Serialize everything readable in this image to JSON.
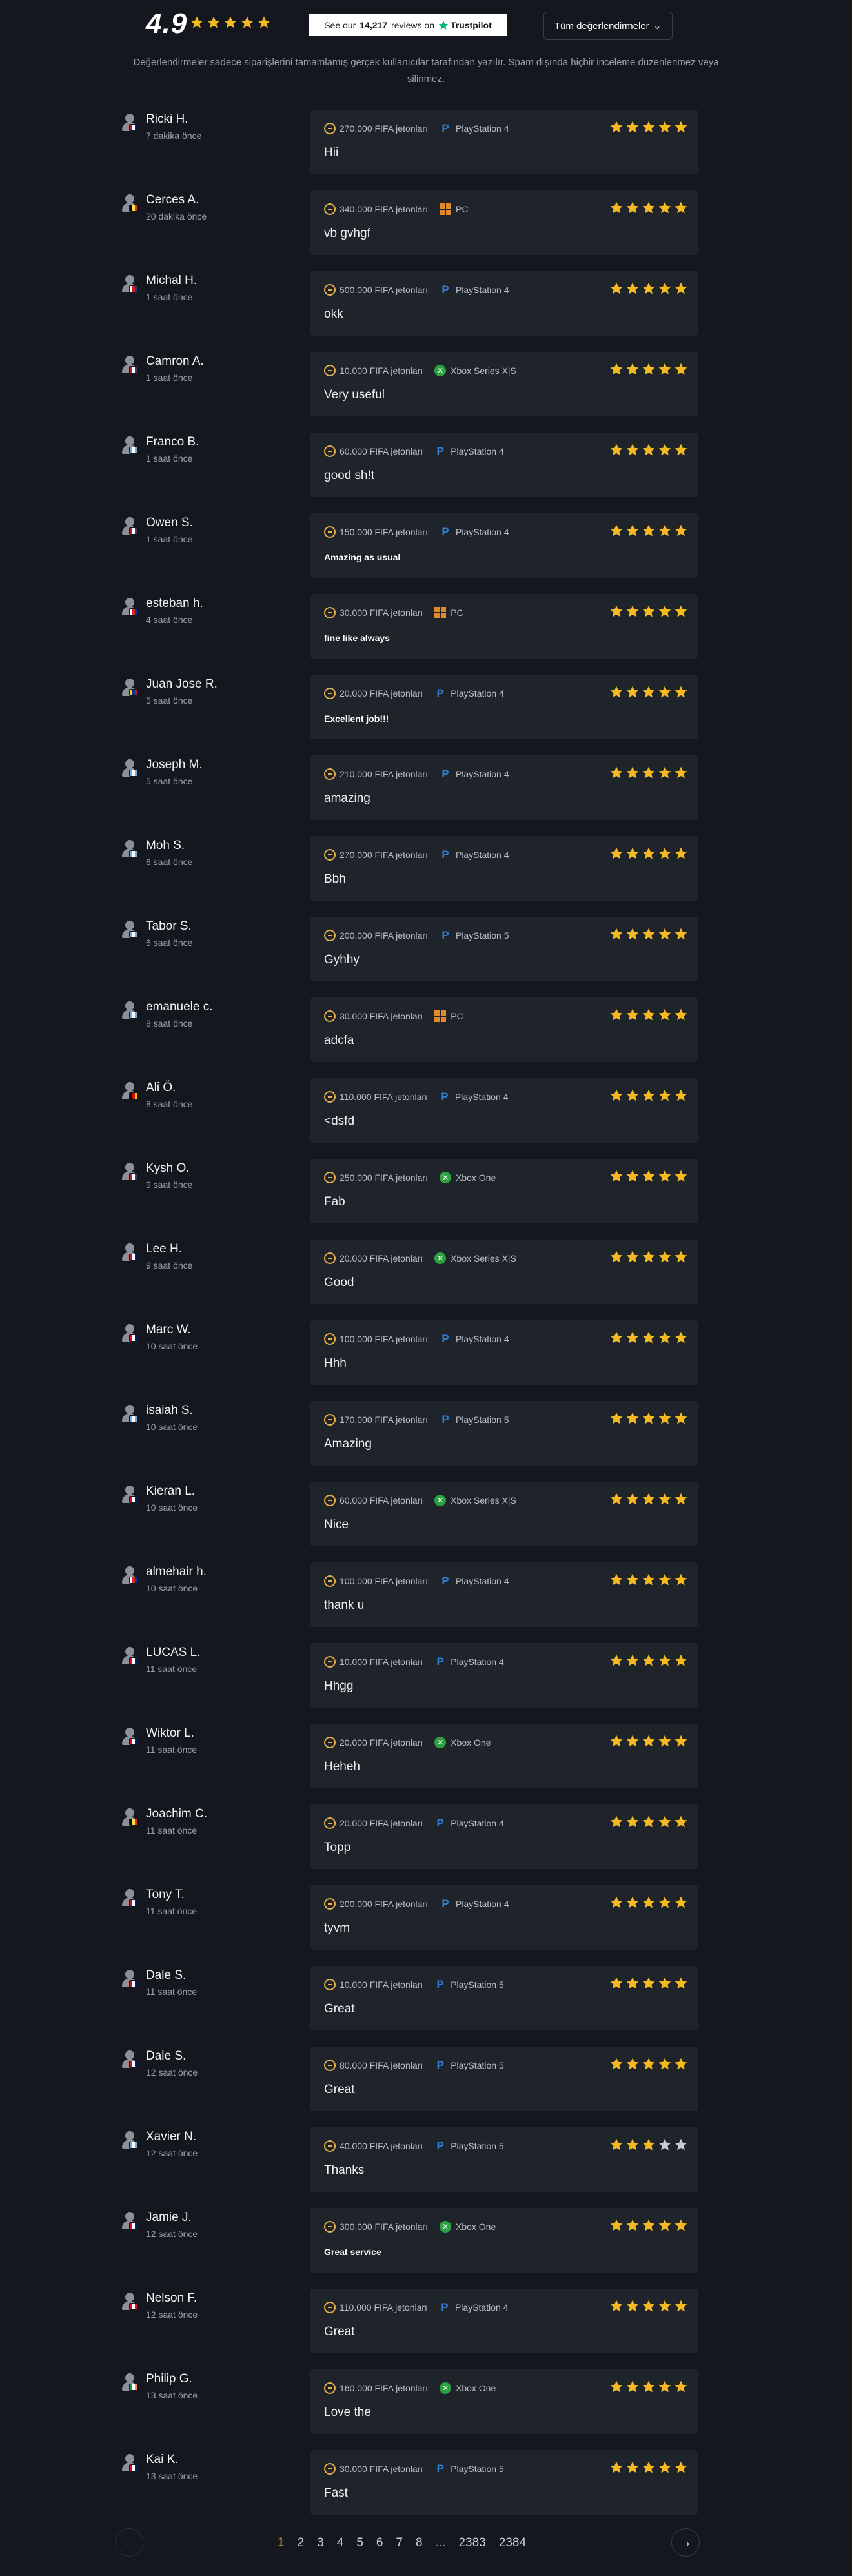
{
  "header": {
    "rating": "4.9",
    "trustpilot": {
      "prefix": "See our",
      "count": "14,217",
      "suffix": "reviews on",
      "brand": "Trustpilot"
    },
    "all_reviews_label": "Tüm değerlendirmeler",
    "notice": "Değerlendirmeler sadece siparişlerini tamamlamış gerçek kullanıcılar tarafından yazılır. Spam dışında hiçbir inceleme düzenlenmez veya silinmez."
  },
  "colors": {
    "star": "#f5b921",
    "star_empty": "#c9ccd2",
    "accent": "#f0b93a",
    "playstation": "#2f7fd6",
    "xbox": "#2ea043",
    "pc": "#e4892b"
  },
  "reviews": [
    {
      "name": "Ricki H.",
      "time": "7 dakika önce",
      "flag": "uk",
      "coins": "270.000 FIFA jetonları",
      "platform": "PlayStation 4",
      "platform_icon": "playstation-icon",
      "text": "Hii",
      "small": false,
      "rating": 5
    },
    {
      "name": "Cerces A.",
      "time": "20 dakika önce",
      "flag": "be",
      "coins": "340.000 FIFA jetonları",
      "platform": "PC",
      "platform_icon": "windows-icon",
      "text": "vb gvhgf",
      "small": false,
      "rating": 5
    },
    {
      "name": "Michal H.",
      "time": "1 saat önce",
      "flag": "cz",
      "coins": "500.000 FIFA jetonları",
      "platform": "PlayStation 4",
      "platform_icon": "playstation-icon",
      "text": "okk",
      "small": false,
      "rating": 5
    },
    {
      "name": "Camron A.",
      "time": "1 saat önce",
      "flag": "us",
      "coins": "10.000 FIFA jetonları",
      "platform": "Xbox Series X|S",
      "platform_icon": "xbox-icon",
      "text": "Very useful",
      "small": false,
      "rating": 5
    },
    {
      "name": "Franco B.",
      "time": "1 saat önce",
      "flag": "ar",
      "coins": "60.000 FIFA jetonları",
      "platform": "PlayStation 4",
      "platform_icon": "playstation-icon",
      "text": "good sh!t",
      "small": false,
      "rating": 5
    },
    {
      "name": "Owen S.",
      "time": "1 saat önce",
      "flag": "us",
      "coins": "150.000 FIFA jetonları",
      "platform": "PlayStation 4",
      "platform_icon": "playstation-icon",
      "text": "Amazing as usual",
      "small": true,
      "rating": 5
    },
    {
      "name": "esteban h.",
      "time": "4 saat önce",
      "flag": "cl",
      "coins": "30.000 FIFA jetonları",
      "platform": "PC",
      "platform_icon": "windows-icon",
      "text": "fine like always",
      "small": true,
      "rating": 5
    },
    {
      "name": "Juan Jose R.",
      "time": "5 saat önce",
      "flag": "co",
      "coins": "20.000 FIFA jetonları",
      "platform": "PlayStation 4",
      "platform_icon": "playstation-icon",
      "text": "Excellent job!!!",
      "small": true,
      "rating": 5
    },
    {
      "name": "Joseph M.",
      "time": "5 saat önce",
      "flag": "ar",
      "coins": "210.000 FIFA jetonları",
      "platform": "PlayStation 4",
      "platform_icon": "playstation-icon",
      "text": "amazing",
      "small": false,
      "rating": 5
    },
    {
      "name": "Moh S.",
      "time": "6 saat önce",
      "flag": "ar",
      "coins": "270.000 FIFA jetonları",
      "platform": "PlayStation 4",
      "platform_icon": "playstation-icon",
      "text": "Bbh",
      "small": false,
      "rating": 5
    },
    {
      "name": "Tabor S.",
      "time": "6 saat önce",
      "flag": "ar",
      "coins": "200.000 FIFA jetonları",
      "platform": "PlayStation 5",
      "platform_icon": "playstation-icon",
      "text": "Gyhhy",
      "small": false,
      "rating": 5
    },
    {
      "name": "emanuele c.",
      "time": "8 saat önce",
      "flag": "ar",
      "coins": "30.000 FIFA jetonları",
      "platform": "PC",
      "platform_icon": "windows-icon",
      "text": "adcfa",
      "small": false,
      "rating": 5
    },
    {
      "name": "Ali Ö.",
      "time": "8 saat önce",
      "flag": "de",
      "coins": "110.000 FIFA jetonları",
      "platform": "PlayStation 4",
      "platform_icon": "playstation-icon",
      "text": "<dsfd",
      "small": false,
      "rating": 5
    },
    {
      "name": "Kysh O.",
      "time": "9 saat önce",
      "flag": "us",
      "coins": "250.000 FIFA jetonları",
      "platform": "Xbox One",
      "platform_icon": "xbox-icon",
      "text": "Fab",
      "small": false,
      "rating": 5
    },
    {
      "name": "Lee H.",
      "time": "9 saat önce",
      "flag": "uk",
      "coins": "20.000 FIFA jetonları",
      "platform": "Xbox Series X|S",
      "platform_icon": "xbox-icon",
      "text": "Good",
      "small": false,
      "rating": 5
    },
    {
      "name": "Marc W.",
      "time": "10 saat önce",
      "flag": "uk",
      "coins": "100.000 FIFA jetonları",
      "platform": "PlayStation 4",
      "platform_icon": "playstation-icon",
      "text": "Hhh",
      "small": false,
      "rating": 5
    },
    {
      "name": "isaiah S.",
      "time": "10 saat önce",
      "flag": "ar",
      "coins": "170.000 FIFA jetonları",
      "platform": "PlayStation 5",
      "platform_icon": "playstation-icon",
      "text": "Amazing",
      "small": false,
      "rating": 5
    },
    {
      "name": "Kieran L.",
      "time": "10 saat önce",
      "flag": "uk",
      "coins": "60.000 FIFA jetonları",
      "platform": "Xbox Series X|S",
      "platform_icon": "xbox-icon",
      "text": "Nice",
      "small": false,
      "rating": 5
    },
    {
      "name": "almehair h.",
      "time": "10 saat önce",
      "flag": "cl",
      "coins": "100.000 FIFA jetonları",
      "platform": "PlayStation 4",
      "platform_icon": "playstation-icon",
      "text": "thank u",
      "small": false,
      "rating": 5
    },
    {
      "name": "LUCAS L.",
      "time": "11 saat önce",
      "flag": "uk",
      "coins": "10.000 FIFA jetonları",
      "platform": "PlayStation 4",
      "platform_icon": "playstation-icon",
      "text": "Hhgg",
      "small": false,
      "rating": 5
    },
    {
      "name": "Wiktor L.",
      "time": "11 saat önce",
      "flag": "uk",
      "coins": "20.000 FIFA jetonları",
      "platform": "Xbox One",
      "platform_icon": "xbox-icon",
      "text": "Heheh",
      "small": false,
      "rating": 5
    },
    {
      "name": "Joachim C.",
      "time": "11 saat önce",
      "flag": "be",
      "coins": "20.000 FIFA jetonları",
      "platform": "PlayStation 4",
      "platform_icon": "playstation-icon",
      "text": "Topp",
      "small": false,
      "rating": 5
    },
    {
      "name": "Tony T.",
      "time": "11 saat önce",
      "flag": "uk",
      "coins": "200.000 FIFA jetonları",
      "platform": "PlayStation 4",
      "platform_icon": "playstation-icon",
      "text": "tyvm",
      "small": false,
      "rating": 5
    },
    {
      "name": "Dale S.",
      "time": "11 saat önce",
      "flag": "uk",
      "coins": "10.000 FIFA jetonları",
      "platform": "PlayStation 5",
      "platform_icon": "playstation-icon",
      "text": "Great",
      "small": false,
      "rating": 5
    },
    {
      "name": "Dale S.",
      "time": "12 saat önce",
      "flag": "uk",
      "coins": "80.000 FIFA jetonları",
      "platform": "PlayStation 5",
      "platform_icon": "playstation-icon",
      "text": "Great",
      "small": false,
      "rating": 5
    },
    {
      "name": "Xavier N.",
      "time": "12 saat önce",
      "flag": "ar",
      "coins": "40.000 FIFA jetonları",
      "platform": "PlayStation 5",
      "platform_icon": "playstation-icon",
      "text": "Thanks",
      "small": false,
      "rating": 3
    },
    {
      "name": "Jamie J.",
      "time": "12 saat önce",
      "flag": "uk",
      "coins": "300.000 FIFA jetonları",
      "platform": "Xbox One",
      "platform_icon": "xbox-icon",
      "text": "Great service",
      "small": true,
      "rating": 5
    },
    {
      "name": "Nelson F.",
      "time": "12 saat önce",
      "flag": "pe",
      "coins": "110.000 FIFA jetonları",
      "platform": "PlayStation 4",
      "platform_icon": "playstation-icon",
      "text": "Great",
      "small": false,
      "rating": 5
    },
    {
      "name": "Philip G.",
      "time": "13 saat önce",
      "flag": "ie",
      "coins": "160.000 FIFA jetonları",
      "platform": "Xbox One",
      "platform_icon": "xbox-icon",
      "text": "Love the",
      "small": false,
      "rating": 5
    },
    {
      "name": "Kai K.",
      "time": "13 saat önce",
      "flag": "uk",
      "coins": "30.000 FIFA jetonları",
      "platform": "PlayStation 5",
      "platform_icon": "playstation-icon",
      "text": "Fast",
      "small": false,
      "rating": 5
    }
  ],
  "pagination": {
    "current": "1",
    "pages": [
      "1",
      "2",
      "3",
      "4",
      "5",
      "6",
      "7",
      "8",
      "...",
      "2383",
      "2384"
    ],
    "prev_icon": "arrow-left-icon",
    "next_icon": "arrow-right-icon"
  }
}
